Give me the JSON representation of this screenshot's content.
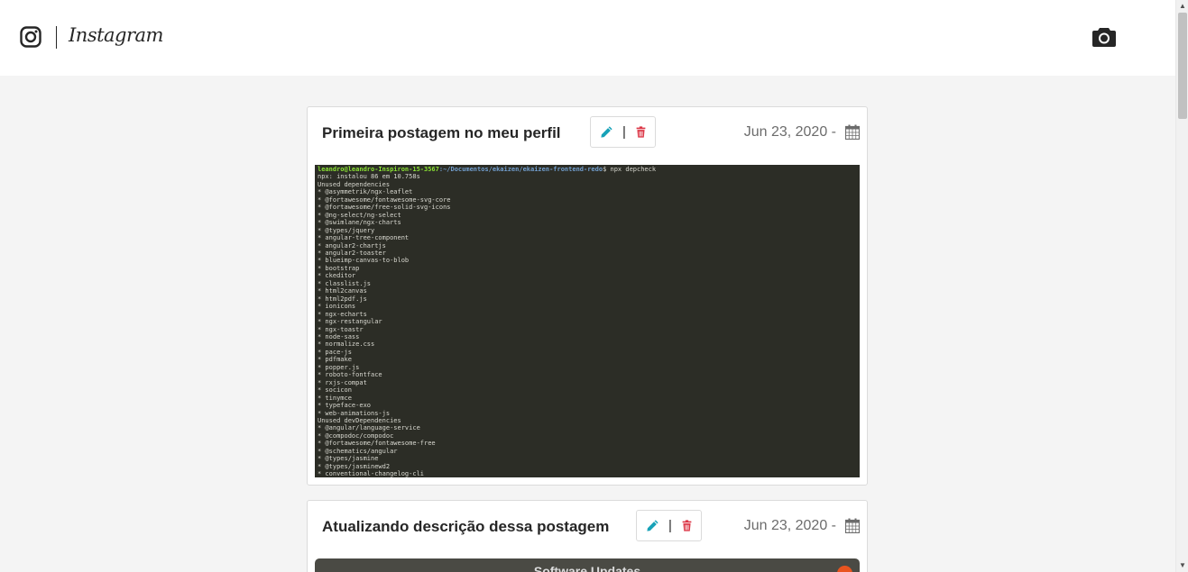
{
  "header": {
    "logo_text": "Instagram"
  },
  "posts": [
    {
      "title": "Primeira postagem no meu perfil",
      "separator": "|",
      "date": "Jun 23, 2020 -",
      "terminal": {
        "prompt_user": "leandro@leandro-Inspiron-15-3567",
        "prompt_path": ":~/Documentos/ekaizen/ekaizen-frontend-redo",
        "command": "$ npx depcheck",
        "lines": [
          "npx: instalou 86 em 10.758s",
          "Unused dependencies",
          "* @asymmetrik/ngx-leaflet",
          "* @fortawesome/fontawesome-svg-core",
          "* @fortawesome/free-solid-svg-icons",
          "* @ng-select/ng-select",
          "* @swimlane/ngx-charts",
          "* @types/jquery",
          "* angular-tree-component",
          "* angular2-chartjs",
          "* angular2-toaster",
          "* blueimp-canvas-to-blob",
          "* bootstrap",
          "* ckeditor",
          "* classlist.js",
          "* html2canvas",
          "* html2pdf.js",
          "* ionicons",
          "* ngx-echarts",
          "* ngx-restangular",
          "* ngx-toastr",
          "* node-sass",
          "* normalize.css",
          "* pace-js",
          "* pdfmake",
          "* popper.js",
          "* roboto-fontface",
          "* rxjs-compat",
          "* socicon",
          "* tinymce",
          "* typeface-exo",
          "* web-animations-js",
          "Unused devDependencies",
          "* @angular/language-service",
          "* @compodoc/compodoc",
          "* @fortawesome/fontawesome-free",
          "* @schematics/angular",
          "* @types/jasmine",
          "* @types/jasminewd2",
          "* conventional-changelog-cli"
        ]
      }
    },
    {
      "title": "Atualizando descrição dessa postagem",
      "separator": "|",
      "date": "Jun 23, 2020 -",
      "image_caption": "Software Updates"
    }
  ],
  "colors": {
    "edit": "#17a2b8",
    "delete": "#dc3545",
    "terminal_bg": "#2c2d26"
  }
}
